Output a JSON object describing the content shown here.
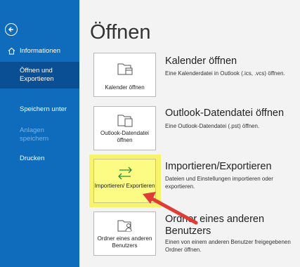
{
  "sidebar": {
    "back_icon": "back-arrow-icon",
    "items": [
      {
        "label": "Informationen"
      },
      {
        "label": "Öffnen und Exportieren"
      },
      {
        "label": "Speichern unter"
      },
      {
        "label": "Anlagen speichern"
      },
      {
        "label": "Drucken"
      }
    ]
  },
  "page": {
    "title": "Öffnen"
  },
  "options": [
    {
      "tile_label": "Kalender öffnen",
      "title": "Kalender öffnen",
      "description": "Eine Kalenderdatei in Outlook (.ics, .vcs) öffnen.",
      "icon": "folder-calendar-icon"
    },
    {
      "tile_label": "Outlook-Datendatei öffnen",
      "title": "Outlook-Datendatei öffnen",
      "description": "Eine Outlook-Datendatei (.pst) öffnen.",
      "icon": "folder-data-icon"
    },
    {
      "tile_label": "Importieren/ Exportieren",
      "title": "Importieren/Exportieren",
      "description": "Dateien und Einstellungen importieren oder exportieren.",
      "icon": "import-export-arrows-icon"
    },
    {
      "tile_label": "Ordner eines anderen Benutzers",
      "title": "Ordner eines anderen Benutzers",
      "description": "Einen von einem anderen Benutzer freigegebenen Ordner öffnen.",
      "icon": "shared-folder-icon"
    }
  ],
  "colors": {
    "sidebar": "#0f6cbd",
    "sidebar_selected": "#0a4f94",
    "highlight": "#f7f36a",
    "annotation_arrow": "#e03c36"
  }
}
